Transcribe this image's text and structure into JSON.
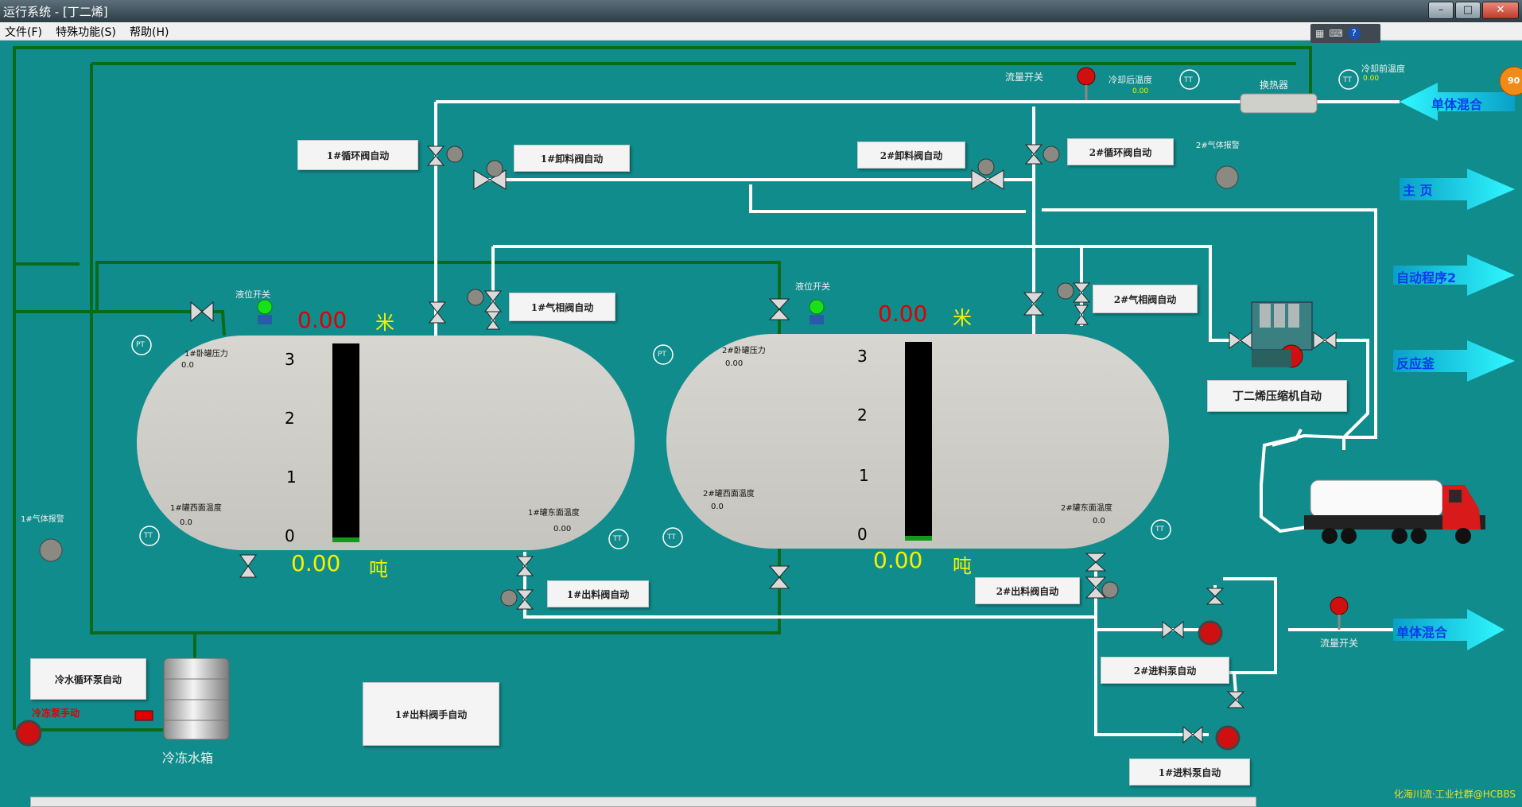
{
  "window": {
    "title": "运行系统 - [丁二烯]"
  },
  "menu": {
    "file": "文件(F)",
    "special": "特殊功能(S)",
    "help": "帮助(H)"
  },
  "buttons": {
    "tank1_circ_valve": "1#循环阀自动",
    "tank1_discharge_valve": "1#卸料阀自动",
    "tank2_discharge_valve": "2#卸料阀自动",
    "tank2_circ_valve": "2#循环阀自动",
    "tank1_gas_valve": "1#气相阀自动",
    "tank2_gas_valve": "2#气相阀自动",
    "compressor": "丁二烯压缩机自动",
    "tank1_outlet_valve": "1#出料阀自动",
    "tank2_outlet_valve": "2#出料阀自动",
    "feed_pump2": "2#进料泵自动",
    "feed_pump1": "1#进料泵自动",
    "cool_pump": "冷水循环泵自动",
    "outlet_manual": "1#出料阀手自动"
  },
  "labels": {
    "flow_switch_top": "流量开关",
    "after_cool_temp": "冷却后温度",
    "after_cool_temp_val": "0.00",
    "heat_exchanger": "换热器",
    "before_cool_temp": "冷却前温度",
    "before_cool_temp_val": "0.00",
    "gas_alarm2": "2#气体报警",
    "gas_alarm1": "1#气体报警",
    "level_switch1": "液位开关",
    "level_switch2": "液位开关",
    "flow_switch_bottom": "流量开关",
    "cool_pump_manual": "冷冻泵手动",
    "cool_tank": "冷冻水箱",
    "pt": "PT",
    "tt": "TT"
  },
  "tank1": {
    "pressure_label": "1#卧罐压力",
    "pressure_val": "0.0",
    "west_temp_label": "1#罐西面温度",
    "west_temp_val": "0.0",
    "east_temp_label": "1#罐东面温度",
    "east_temp_val": "0.00",
    "level": "0.00",
    "level_unit": "米",
    "weight": "0.00",
    "weight_unit": "吨",
    "scale": [
      "3",
      "2",
      "1",
      "0"
    ],
    "level_fraction": 0.02
  },
  "tank2": {
    "pressure_label": "2#卧罐压力",
    "pressure_val": "0.00",
    "west_temp_label": "2#罐西面温度",
    "west_temp_val": "0.0",
    "east_temp_label": "2#罐东面温度",
    "east_temp_val": "0.0",
    "level": "0.00",
    "level_unit": "米",
    "weight": "0.00",
    "weight_unit": "吨",
    "scale": [
      "3",
      "2",
      "1",
      "0"
    ],
    "level_fraction": 0.02
  },
  "nav": {
    "monomer_mix_top": "单体混合",
    "home": "主 页",
    "auto_prog2": "自动程序2",
    "reactor": "反应釜",
    "monomer_mix_bottom": "单体混合"
  },
  "corner_badge": "90",
  "footer": "化海川流·工业社群@HCBBS",
  "colors": {
    "background": "#108c8c",
    "pipe_white": "#ffffff",
    "pipe_green": "#0a6a1a",
    "arrow": "#18e0f0"
  }
}
